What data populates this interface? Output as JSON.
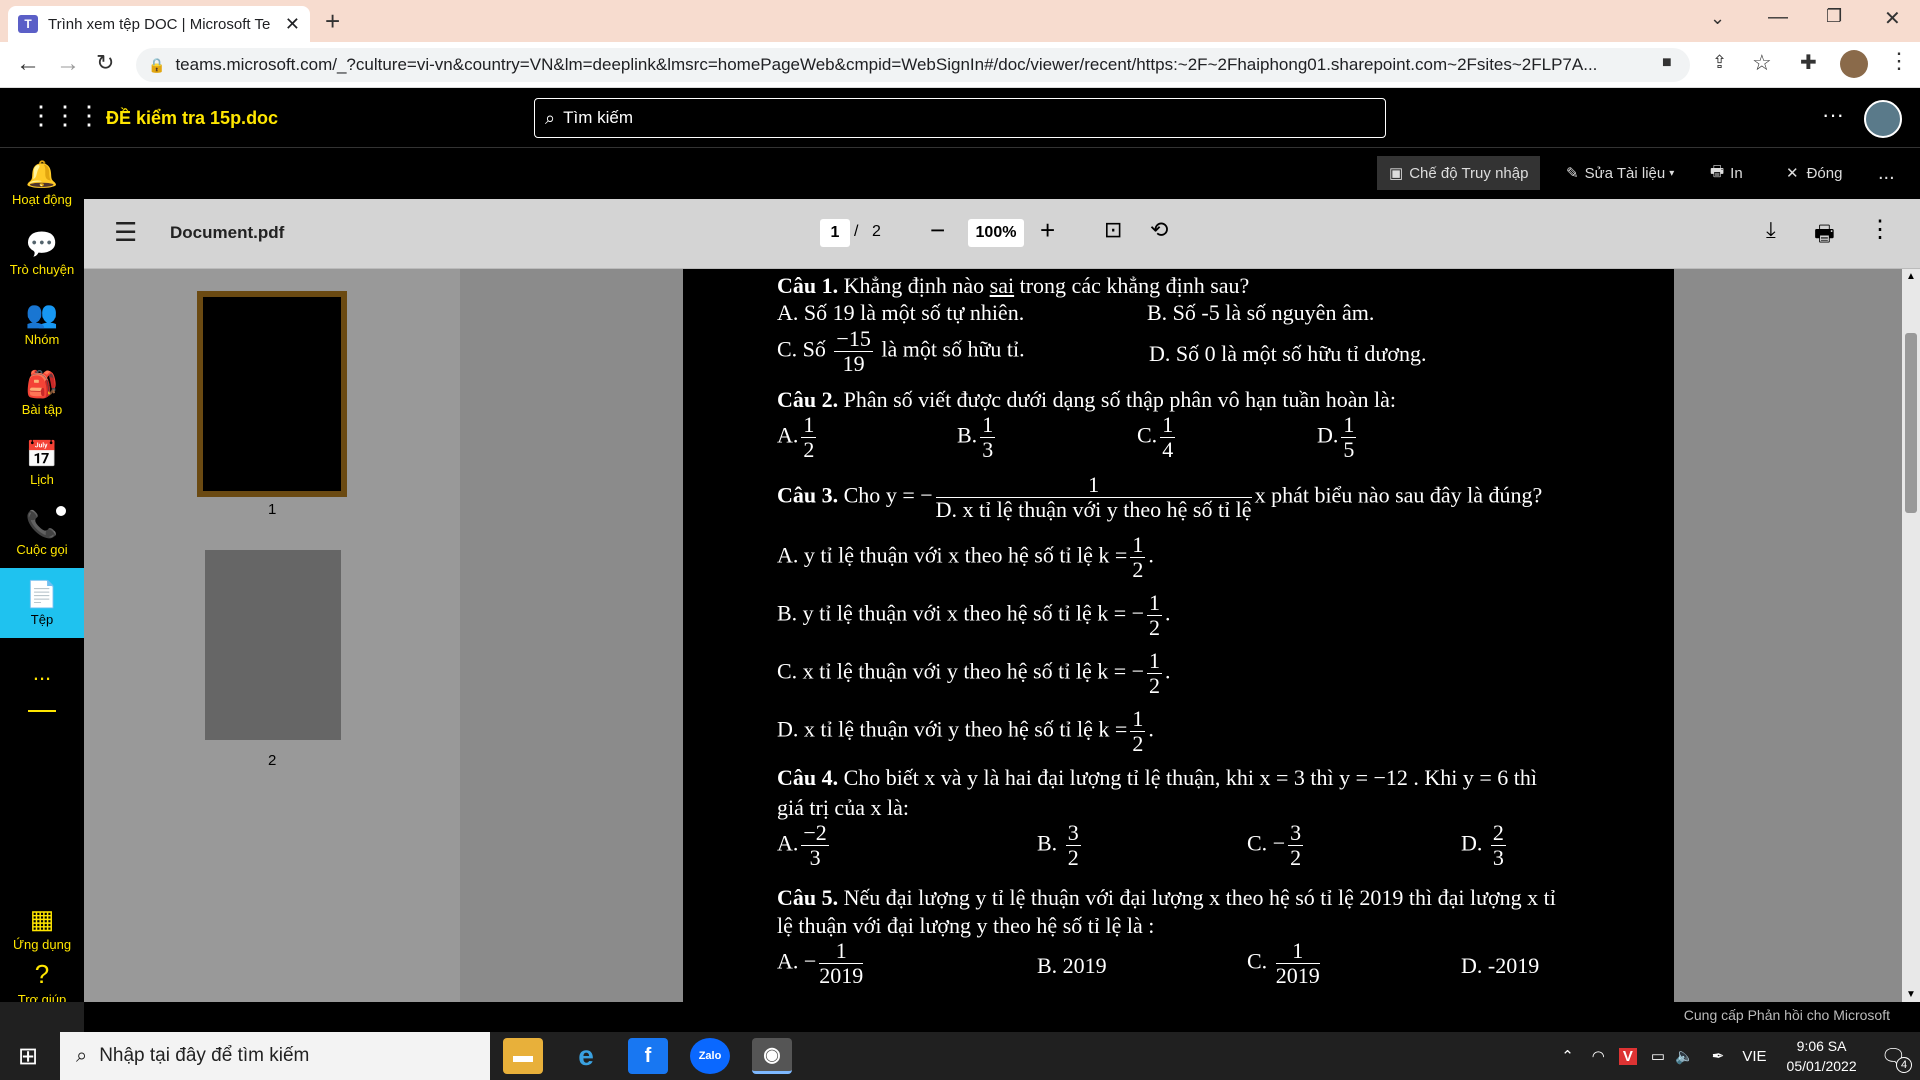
{
  "browser": {
    "tab_title": "Trình xem tệp DOC | Microsoft Te",
    "url": "teams.microsoft.com/_?culture=vi-vn&country=VN&lm=deeplink&lmsrc=homePageWeb&cmpid=WebSignIn#/doc/viewer/recent/https:~2F~2Fhaiphong01.sharepoint.com~2Fsites~2FLP7A..."
  },
  "teams": {
    "file_title": "ĐỀ kiểm tra 15p.doc",
    "search_placeholder": "Tìm kiếm",
    "rail": [
      {
        "label": "Hoạt động",
        "icon": "bell-icon",
        "glyph": "🔔"
      },
      {
        "label": "Trò chuyện",
        "icon": "chat-icon",
        "glyph": "💬"
      },
      {
        "label": "Nhóm",
        "icon": "teams-icon",
        "glyph": "👥"
      },
      {
        "label": "Bài tập",
        "icon": "assignments-icon",
        "glyph": "🎒"
      },
      {
        "label": "Lịch",
        "icon": "calendar-icon",
        "glyph": "📅"
      },
      {
        "label": "Cuộc gọi",
        "icon": "phone-icon",
        "glyph": "📞"
      },
      {
        "label": "Tệp",
        "icon": "file-icon",
        "glyph": "📄"
      }
    ],
    "rail_more": "...",
    "apps_label": "Ứng dụng",
    "help_label": "Trợ giúp",
    "cmd": {
      "access_mode": "Chế độ Truy nhập",
      "edit": "Sửa Tài liệu",
      "print": "In",
      "close": "Đóng",
      "more": "..."
    }
  },
  "pdf": {
    "filename": "Document.pdf",
    "page_current": "1",
    "page_sep": "/",
    "page_total": "2",
    "zoom": "100%",
    "thumb_labels": [
      "1",
      "2"
    ]
  },
  "doc": {
    "q1": {
      "label": "Câu 1.",
      "text": " Khẳng định nào ",
      "sai": "sai",
      "rest": " trong các khẳng định sau?",
      "a": "A. Số 19 là một số tự nhiên.",
      "b": "B. Số -5 là số nguyên âm.",
      "c_pre": "C. Số",
      "c_num": "−15",
      "c_den": "19",
      "c_post": "là một số hữu tỉ.",
      "d": "D. Số 0 là một số hữu tỉ dương."
    },
    "q2": {
      "label": "Câu 2.",
      "text": " Phân số viết được dưới dạng số thập phân vô hạn tuần hoàn là:",
      "opts": [
        {
          "l": "A.",
          "n": "1",
          "d": "2"
        },
        {
          "l": "B.",
          "n": "1",
          "d": "3"
        },
        {
          "l": "C.",
          "n": "1",
          "d": "4"
        },
        {
          "l": "D.",
          "n": "1",
          "d": "5"
        }
      ]
    },
    "q3": {
      "label": "Câu 3.",
      "cho": "Cho",
      "y_eq": "y = −",
      "n": "1",
      "d": "D. x tỉ lệ thuận với y theo hệ số tỉ lệ",
      "x_rest": "x phát biểu nào sau đây là đúng?",
      "a": "A. y tỉ lệ thuận với x theo hệ số tỉ lệ",
      "a_k": "k =",
      "a_n": "1",
      "a_d": "2",
      "b": "B. y tỉ lệ thuận với x theo hệ số tỉ lệ",
      "b_k": "k = −",
      "b_n": "1",
      "b_d": "2",
      "c": "C. x tỉ lệ thuận với y theo hệ số tỉ lệ",
      "c_k": "k = −",
      "c_n": "1",
      "c_d": "2",
      "d_k": "k =",
      "d_n": "1",
      "d_d": "2"
    },
    "q4": {
      "label": "Câu 4.",
      "text": " Cho biết x và y là hai đại lượng tỉ lệ thuận, khi  x = 3  thì  y = −12 . Khi  y = 6  thì",
      "text2": "giá trị của x là:",
      "opts": [
        {
          "l": "A.",
          "s": "",
          "n": "−2",
          "d": "3"
        },
        {
          "l": "B.",
          "s": "",
          "n": "3",
          "d": "2"
        },
        {
          "l": "C.",
          "s": "−",
          "n": "3",
          "d": "2"
        },
        {
          "l": "D.",
          "s": "",
          "n": "2",
          "d": "3"
        }
      ]
    },
    "q5": {
      "label": "Câu 5.",
      "text": " Nếu đại lượng y tỉ lệ thuận với đại lượng x theo hệ só tỉ lệ 2019 thì đại lượng x tỉ",
      "text2": "lệ thuận với đại lượng y theo hệ số tỉ lệ là :",
      "a_l": "A. −",
      "a_n": "1",
      "a_d": "2019",
      "b": "B. 2019",
      "c_l": "C.",
      "c_n": "1",
      "c_d": "2019",
      "d": "D. -2019"
    }
  },
  "feedback": "Cung cấp Phản hồi cho Microsoft",
  "taskbar": {
    "search_placeholder": "Nhập tại đây để tìm kiếm",
    "lang": "VIE",
    "time": "9:06 SA",
    "date": "05/01/2022",
    "notif_count": "4"
  }
}
